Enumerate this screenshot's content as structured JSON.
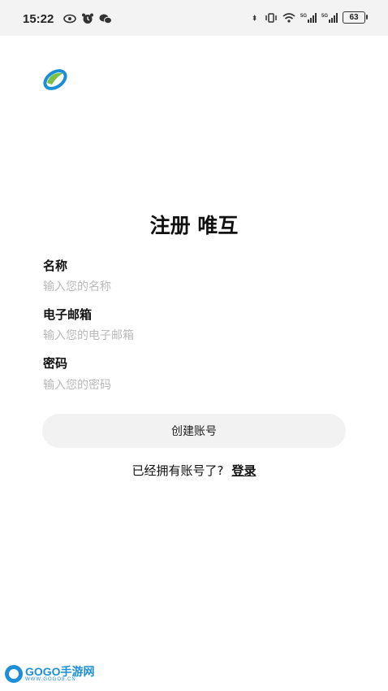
{
  "status_bar": {
    "time": "15:22",
    "left_icons": [
      "eye-icon",
      "alarm-icon",
      "wechat-icon"
    ],
    "right_icons": [
      "bluetooth-icon",
      "vibrate-icon",
      "wifi-icon",
      "signal-5g-icon",
      "signal-5g-icon"
    ],
    "battery": "63"
  },
  "brand": {
    "logo_colors": [
      "#7ac143",
      "#1a8fd8"
    ]
  },
  "page": {
    "title": "注册 唯互"
  },
  "form": {
    "name": {
      "label": "名称",
      "placeholder": "输入您的名称",
      "value": ""
    },
    "email": {
      "label": "电子邮箱",
      "placeholder": "输入您的电子邮箱",
      "value": ""
    },
    "password": {
      "label": "密码",
      "placeholder": "输入您的密码",
      "value": ""
    },
    "submit_label": "创建账号"
  },
  "footer": {
    "prompt": "已经拥有账号了?",
    "login_label": "登录"
  },
  "watermark": {
    "main": "GOGO手游网",
    "sub": "WWW.GOGO8.CN"
  }
}
